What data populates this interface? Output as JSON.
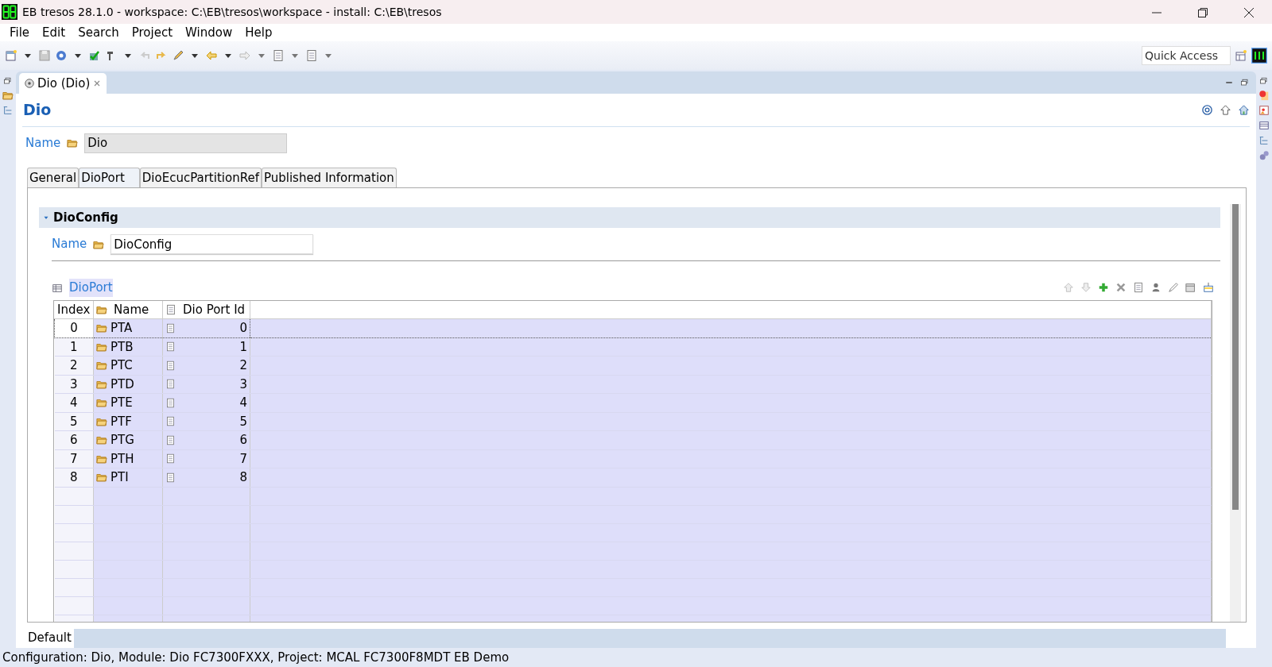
{
  "window": {
    "title": "EB tresos 28.1.0 - workspace: C:\\EB\\tresos\\workspace - install: C:\\EB\\tresos"
  },
  "menu": [
    "File",
    "Edit",
    "Search",
    "Project",
    "Window",
    "Help"
  ],
  "quick_access": {
    "placeholder": "Quick Access"
  },
  "editor_tab": {
    "label": "Dio (Dio)"
  },
  "editor": {
    "title": "Dio",
    "name_label": "Name",
    "name_value": "Dio",
    "tabs": [
      {
        "label": "General",
        "selected": false
      },
      {
        "label": "DioPort",
        "selected": true
      },
      {
        "label": "DioEcucPartitionRef",
        "selected": false
      },
      {
        "label": "Published Information",
        "selected": false
      }
    ],
    "section": {
      "title": "DioConfig",
      "expanded": true,
      "name_label": "Name",
      "name_value": "DioConfig",
      "table_title": "DioPort",
      "columns": [
        "Index",
        "Name",
        "Dio Port Id"
      ],
      "rows": [
        {
          "index": "0",
          "name": "PTA",
          "id": "0",
          "selected": true
        },
        {
          "index": "1",
          "name": "PTB",
          "id": "1",
          "selected": false
        },
        {
          "index": "2",
          "name": "PTC",
          "id": "2",
          "selected": false
        },
        {
          "index": "3",
          "name": "PTD",
          "id": "3",
          "selected": false
        },
        {
          "index": "4",
          "name": "PTE",
          "id": "4",
          "selected": false
        },
        {
          "index": "5",
          "name": "PTF",
          "id": "5",
          "selected": false
        },
        {
          "index": "6",
          "name": "PTG",
          "id": "6",
          "selected": false
        },
        {
          "index": "7",
          "name": "PTH",
          "id": "7",
          "selected": false
        },
        {
          "index": "8",
          "name": "PTI",
          "id": "8",
          "selected": false
        }
      ]
    }
  },
  "bottom_tab": {
    "label": "Default"
  },
  "status_bar": "Configuration: Dio, Module: Dio FC7300FXXX, Project: MCAL FC7300F8MDT EB Demo"
}
